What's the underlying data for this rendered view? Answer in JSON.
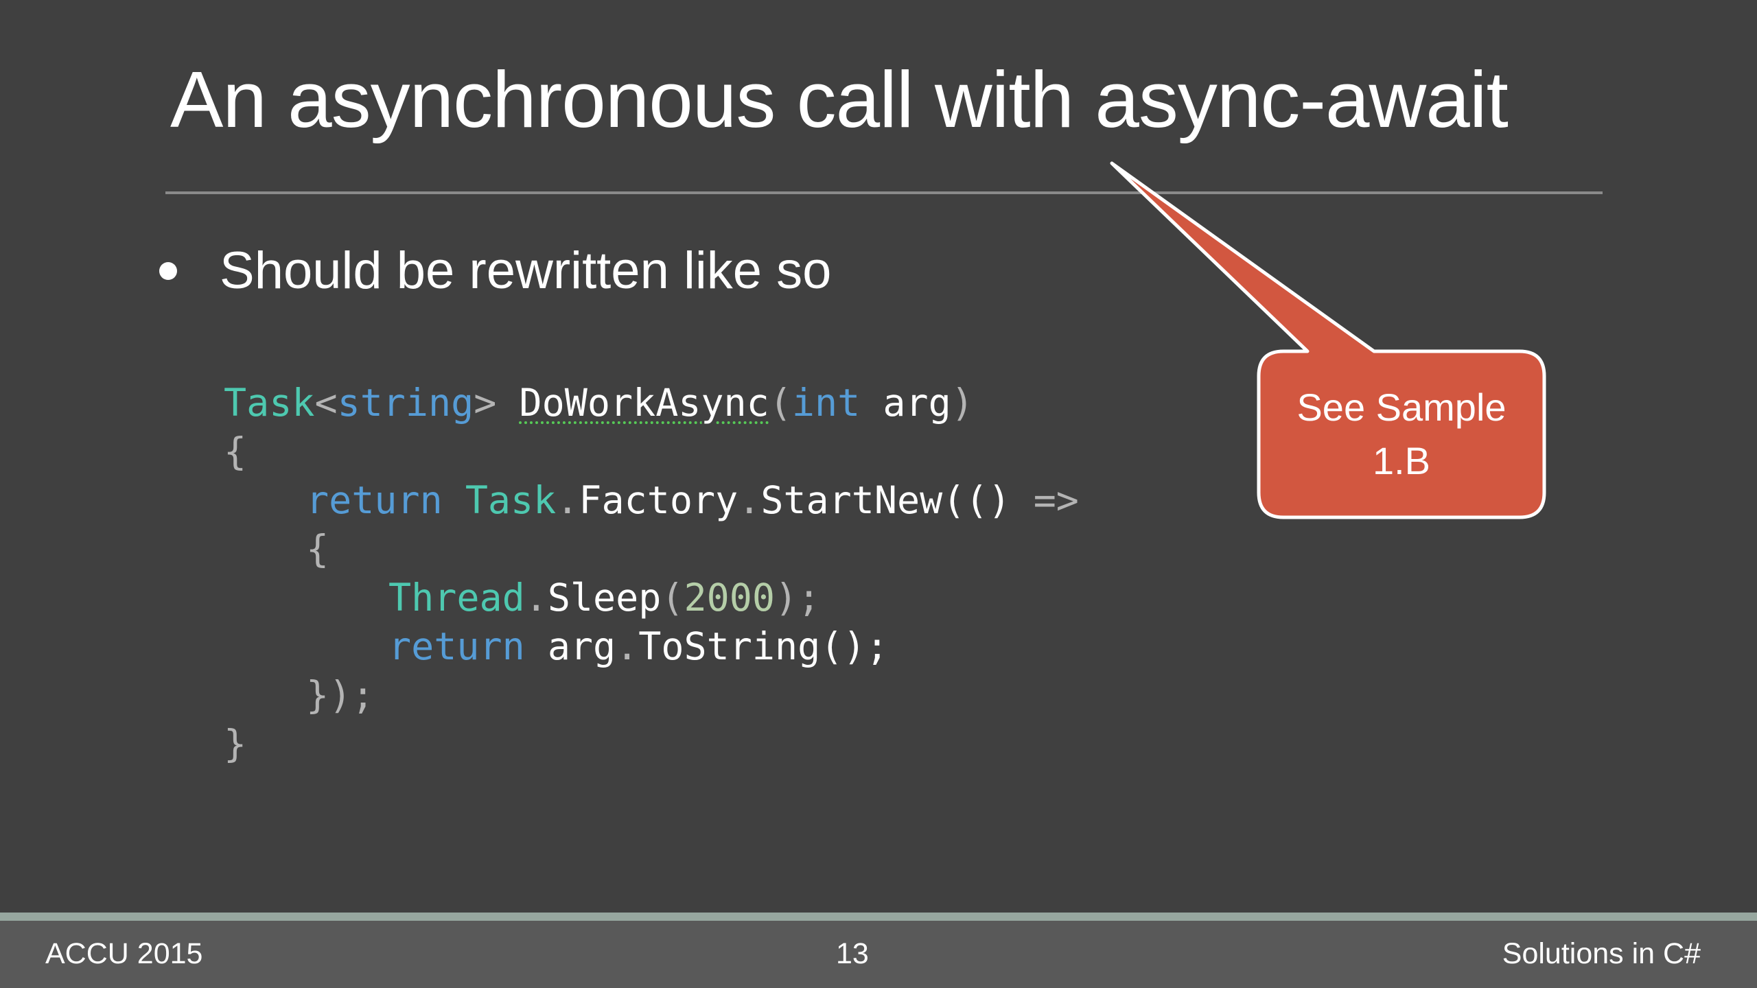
{
  "slide": {
    "title": "An asynchronous call with async-await",
    "bullet": "Should be rewritten like so",
    "callout": {
      "line1": "See Sample",
      "line2": "1.B",
      "fill_color": "#d25740",
      "border_color": "#ffffff"
    }
  },
  "code": {
    "line1": {
      "type": "Task",
      "lt": "<",
      "generic": "string",
      "gt": ">",
      "method": "DoWorkAsync",
      "open": "(",
      "kw": "int",
      "param": "arg",
      "close": ")"
    },
    "line2": {
      "brace": "{"
    },
    "line3": {
      "kw": "return",
      "type": "Task",
      "dot1": ".",
      "prop": "Factory",
      "dot2": ".",
      "method": "StartNew",
      "parens": "(()",
      "arrow": "=>"
    },
    "line4": {
      "brace": "{"
    },
    "line5": {
      "type": "Thread",
      "dot": ".",
      "method": "Sleep",
      "open": "(",
      "num": "2000",
      "close": ");"
    },
    "line6": {
      "kw": "return",
      "id": "arg",
      "dot": ".",
      "method": "ToString",
      "tail": "();"
    },
    "line7": {
      "text": "});"
    },
    "line8": {
      "brace": "}"
    }
  },
  "footer": {
    "left": "ACCU 2015",
    "page": "13",
    "right": "Solutions in C#"
  },
  "colors": {
    "background": "#404040",
    "footer": "#595959",
    "footer_accent": "#97a79f",
    "code_type": "#4ec9b0",
    "code_keyword": "#569cd6",
    "code_number": "#b5cea8"
  }
}
